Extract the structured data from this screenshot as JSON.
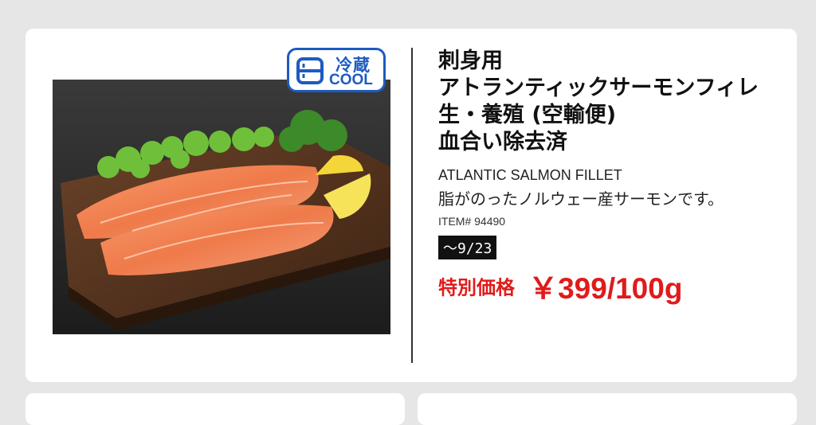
{
  "badge": {
    "line1": "冷蔵",
    "line2": "COOL",
    "color": "#1d5bbf"
  },
  "product": {
    "title_lines": [
      "刺身用",
      "アトランティックサーモンフィレ",
      "生・養殖 (空輸便)",
      "血合い除去済"
    ],
    "english_name": "ATLANTIC SALMON FILLET",
    "description": "脂がのったノルウェー産サーモンです。",
    "item_number": "ITEM# 94490",
    "valid_until": "～9/23",
    "price_label": "特別価格",
    "price": "￥399/100g",
    "price_color": "#e01b1b",
    "image_icon": "salmon-fillet-photo"
  }
}
